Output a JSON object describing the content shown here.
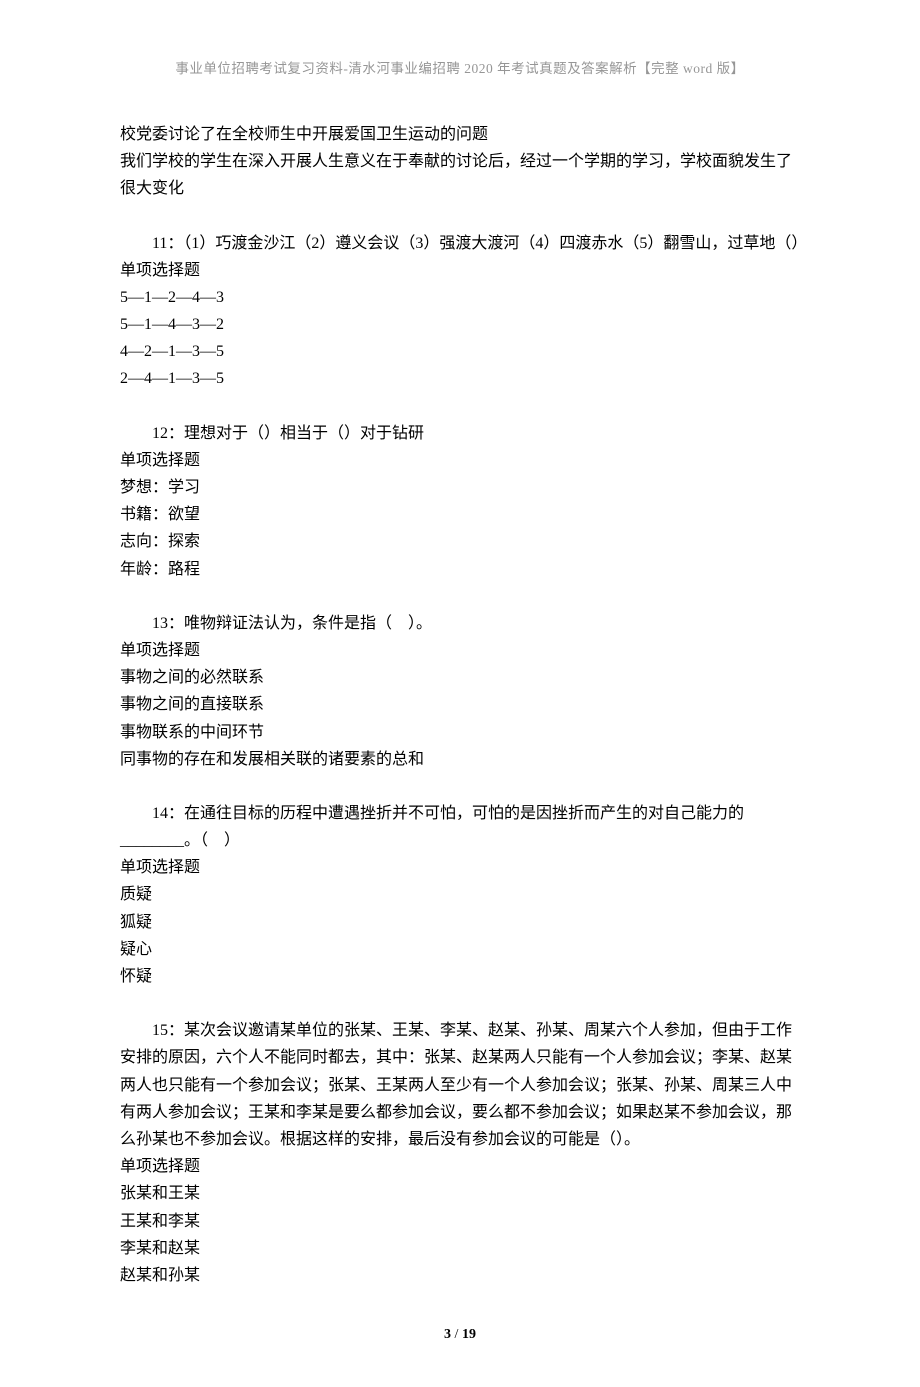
{
  "header": "事业单位招聘考试复习资料-清水河事业编招聘 2020 年考试真题及答案解析【完整 word 版】",
  "orphan_lines": [
    "校党委讨论了在全校师生中开展爱国卫生运动的问题",
    "我们学校的学生在深入开展人生意义在于奉献的讨论后，经过一个学期的学习，学校面貌发生了很大变化"
  ],
  "q11": {
    "stem": "11：（1）巧渡金沙江（2）遵义会议（3）强渡大渡河（4）四渡赤水（5）翻雪山，过草地（）",
    "type": "单项选择题",
    "options": [
      "5—1—2—4—3",
      "5—1—4—3—2",
      "4—2—1—3—5",
      "2—4—1—3—5"
    ]
  },
  "q12": {
    "stem": "12：理想对于（）相当于（）对于钻研",
    "type": "单项选择题",
    "options": [
      "梦想：学习",
      "书籍：欲望",
      "志向：探索",
      "年龄：路程"
    ]
  },
  "q13": {
    "stem": "13：唯物辩证法认为，条件是指（　）。",
    "type": "单项选择题",
    "options": [
      "事物之间的必然联系",
      "事物之间的直接联系",
      "事物联系的中间环节",
      "同事物的存在和发展相关联的诸要素的总和"
    ]
  },
  "q14": {
    "stem": "14：在通往目标的历程中遭遇挫折并不可怕，可怕的是因挫折而产生的对自己能力的________。（　）",
    "type": "单项选择题",
    "options": [
      "质疑",
      "狐疑",
      "疑心",
      "怀疑"
    ]
  },
  "q15": {
    "stem": "15：某次会议邀请某单位的张某、王某、李某、赵某、孙某、周某六个人参加，但由于工作安排的原因，六个人不能同时都去，其中：张某、赵某两人只能有一个人参加会议；李某、赵某两人也只能有一个参加会议；张某、王某两人至少有一个人参加会议；张某、孙某、周某三人中有两人参加会议；王某和李某是要么都参加会议，要么都不参加会议；如果赵某不参加会议，那么孙某也不参加会议。根据这样的安排，最后没有参加会议的可能是（）。",
    "type": "单项选择题",
    "options": [
      "张某和王某",
      "王某和李某",
      "李某和赵某",
      "赵某和孙某"
    ]
  },
  "footer": {
    "page_current": "3",
    "page_total": "19"
  }
}
